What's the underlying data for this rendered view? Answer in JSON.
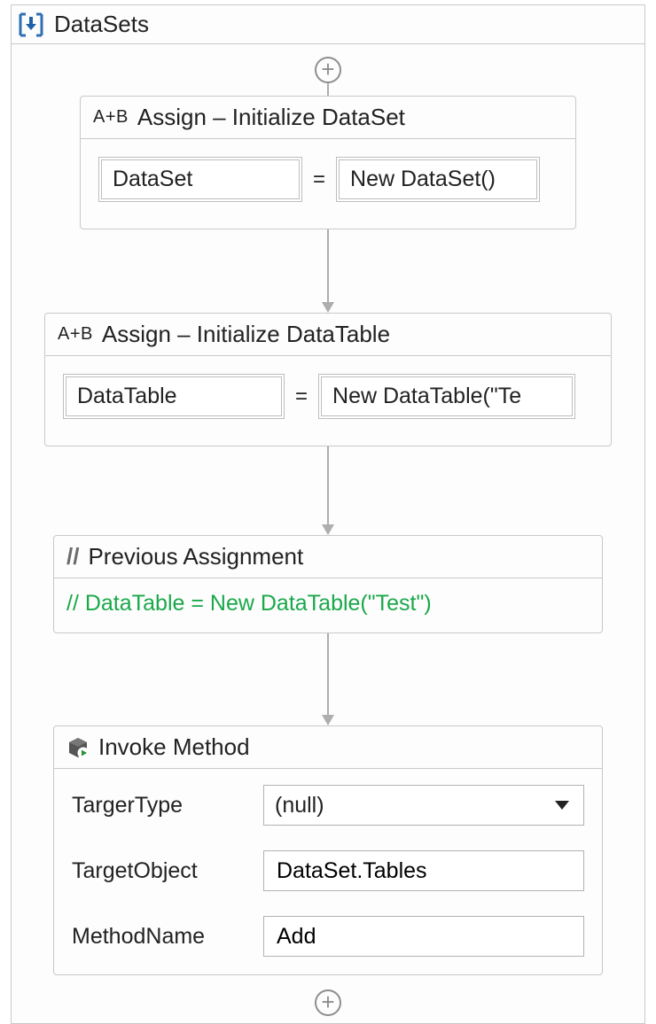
{
  "sequence": {
    "title": "DataSets"
  },
  "icons": {
    "title": "datasets-icon",
    "add": "add-icon",
    "invoke": "cube-play-icon"
  },
  "addLabel": "+",
  "assign1": {
    "prefix": "A+B",
    "title": "Assign – Initialize DataSet",
    "left": "DataSet",
    "right": "New DataSet()"
  },
  "assign2": {
    "prefix": "A+B",
    "title": "Assign – Initialize DataTable",
    "left": "DataTable",
    "right": "New DataTable(\"Te"
  },
  "comment": {
    "prefix": "//",
    "title": "Previous Assignment",
    "body": "// DataTable = New DataTable(\"Test\")"
  },
  "invoke": {
    "title": "Invoke Method",
    "rows": {
      "targetTypeLabel": "TargerType",
      "targetTypeValue": "(null)",
      "targetObjectLabel": "TargetObject",
      "targetObjectValue": "DataSet.Tables",
      "methodNameLabel": "MethodName",
      "methodNameValue": "Add"
    }
  }
}
